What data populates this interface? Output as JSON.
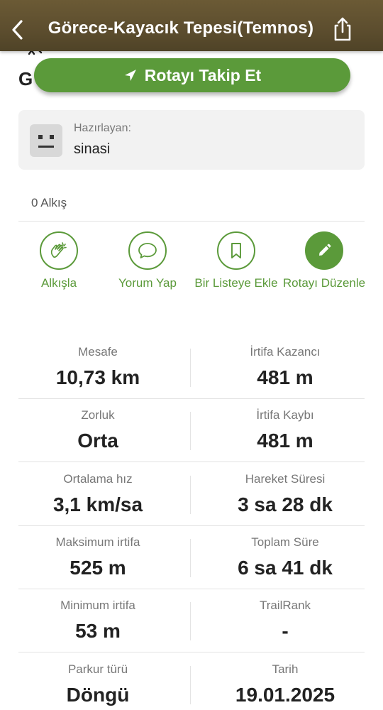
{
  "header": {
    "title": "Görece-Kayacık Tepesi(Temnos)",
    "back_icon": "chevron-left-icon",
    "share_icon": "share-icon"
  },
  "under_header": {
    "title_fragment": "G"
  },
  "follow_button": {
    "label": "Rotayı Takip Et",
    "icon": "navigation-arrow-icon"
  },
  "author": {
    "label": "Hazırlayan:",
    "name": "sinasi"
  },
  "claps": {
    "text": "0 Alkış"
  },
  "actions": [
    {
      "label": "Alkışla",
      "icon": "clap-icon"
    },
    {
      "label": "Yorum Yap",
      "icon": "comment-icon"
    },
    {
      "label": "Bir Listeye Ekle",
      "icon": "bookmark-icon"
    },
    {
      "label": "Rotayı Düzenle",
      "icon": "pencil-icon"
    }
  ],
  "stats": [
    {
      "label": "Mesafe",
      "value": "10,73 km"
    },
    {
      "label": "İrtifa Kazancı",
      "value": "481 m"
    },
    {
      "label": "Zorluk",
      "value": "Orta"
    },
    {
      "label": "İrtifa Kaybı",
      "value": "481 m"
    },
    {
      "label": "Ortalama hız",
      "value": "3,1 km/sa"
    },
    {
      "label": "Hareket Süresi",
      "value": "3 sa 28 dk"
    },
    {
      "label": "Maksimum irtifa",
      "value": "525 m"
    },
    {
      "label": "Toplam Süre",
      "value": "6 sa 41 dk"
    },
    {
      "label": "Minimum irtifa",
      "value": "53 m"
    },
    {
      "label": "TrailRank",
      "value": "-"
    },
    {
      "label": "Parkur türü",
      "value": "Döngü"
    },
    {
      "label": "Tarih",
      "value": "19.01.2025"
    }
  ],
  "colors": {
    "accent": "#5b9a3a",
    "header": "#5c4d2e"
  }
}
